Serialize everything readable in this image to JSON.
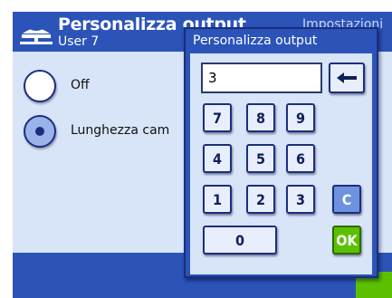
{
  "header": {
    "title": "Personalizza output",
    "user": "User 7",
    "right_label": "Impostazioni"
  },
  "options": [
    {
      "label": "Off",
      "selected": false
    },
    {
      "label": "Lunghezza cam",
      "selected": true
    }
  ],
  "dialog": {
    "title": "Personalizza output",
    "entry_value": "3",
    "keys": {
      "k7": "7",
      "k8": "8",
      "k9": "9",
      "k4": "4",
      "k5": "5",
      "k6": "6",
      "k1": "1",
      "k2": "2",
      "k3": "3",
      "k0": "0",
      "clear": "C",
      "ok": "OK"
    }
  },
  "colors": {
    "primary": "#2b53b8",
    "panel": "#d8e4f7",
    "ok": "#5cc000",
    "clear": "#6e92e0"
  },
  "icons": {
    "header": "scale-icon",
    "backspace": "left-arrow-icon"
  }
}
